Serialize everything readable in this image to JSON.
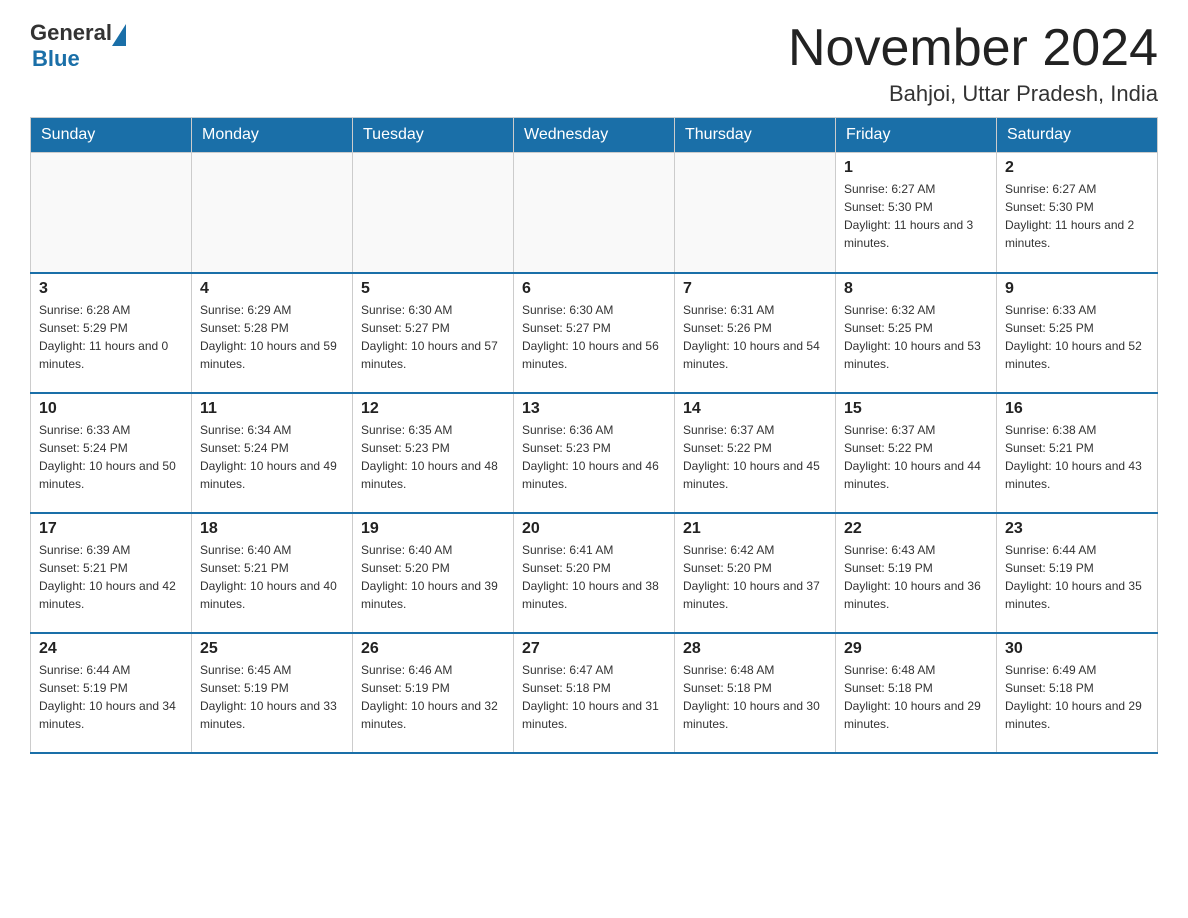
{
  "header": {
    "logo_general": "General",
    "logo_blue": "Blue",
    "title": "November 2024",
    "subtitle": "Bahjoi, Uttar Pradesh, India"
  },
  "days_of_week": [
    "Sunday",
    "Monday",
    "Tuesday",
    "Wednesday",
    "Thursday",
    "Friday",
    "Saturday"
  ],
  "weeks": [
    [
      {
        "day": "",
        "info": ""
      },
      {
        "day": "",
        "info": ""
      },
      {
        "day": "",
        "info": ""
      },
      {
        "day": "",
        "info": ""
      },
      {
        "day": "",
        "info": ""
      },
      {
        "day": "1",
        "info": "Sunrise: 6:27 AM\nSunset: 5:30 PM\nDaylight: 11 hours and 3 minutes."
      },
      {
        "day": "2",
        "info": "Sunrise: 6:27 AM\nSunset: 5:30 PM\nDaylight: 11 hours and 2 minutes."
      }
    ],
    [
      {
        "day": "3",
        "info": "Sunrise: 6:28 AM\nSunset: 5:29 PM\nDaylight: 11 hours and 0 minutes."
      },
      {
        "day": "4",
        "info": "Sunrise: 6:29 AM\nSunset: 5:28 PM\nDaylight: 10 hours and 59 minutes."
      },
      {
        "day": "5",
        "info": "Sunrise: 6:30 AM\nSunset: 5:27 PM\nDaylight: 10 hours and 57 minutes."
      },
      {
        "day": "6",
        "info": "Sunrise: 6:30 AM\nSunset: 5:27 PM\nDaylight: 10 hours and 56 minutes."
      },
      {
        "day": "7",
        "info": "Sunrise: 6:31 AM\nSunset: 5:26 PM\nDaylight: 10 hours and 54 minutes."
      },
      {
        "day": "8",
        "info": "Sunrise: 6:32 AM\nSunset: 5:25 PM\nDaylight: 10 hours and 53 minutes."
      },
      {
        "day": "9",
        "info": "Sunrise: 6:33 AM\nSunset: 5:25 PM\nDaylight: 10 hours and 52 minutes."
      }
    ],
    [
      {
        "day": "10",
        "info": "Sunrise: 6:33 AM\nSunset: 5:24 PM\nDaylight: 10 hours and 50 minutes."
      },
      {
        "day": "11",
        "info": "Sunrise: 6:34 AM\nSunset: 5:24 PM\nDaylight: 10 hours and 49 minutes."
      },
      {
        "day": "12",
        "info": "Sunrise: 6:35 AM\nSunset: 5:23 PM\nDaylight: 10 hours and 48 minutes."
      },
      {
        "day": "13",
        "info": "Sunrise: 6:36 AM\nSunset: 5:23 PM\nDaylight: 10 hours and 46 minutes."
      },
      {
        "day": "14",
        "info": "Sunrise: 6:37 AM\nSunset: 5:22 PM\nDaylight: 10 hours and 45 minutes."
      },
      {
        "day": "15",
        "info": "Sunrise: 6:37 AM\nSunset: 5:22 PM\nDaylight: 10 hours and 44 minutes."
      },
      {
        "day": "16",
        "info": "Sunrise: 6:38 AM\nSunset: 5:21 PM\nDaylight: 10 hours and 43 minutes."
      }
    ],
    [
      {
        "day": "17",
        "info": "Sunrise: 6:39 AM\nSunset: 5:21 PM\nDaylight: 10 hours and 42 minutes."
      },
      {
        "day": "18",
        "info": "Sunrise: 6:40 AM\nSunset: 5:21 PM\nDaylight: 10 hours and 40 minutes."
      },
      {
        "day": "19",
        "info": "Sunrise: 6:40 AM\nSunset: 5:20 PM\nDaylight: 10 hours and 39 minutes."
      },
      {
        "day": "20",
        "info": "Sunrise: 6:41 AM\nSunset: 5:20 PM\nDaylight: 10 hours and 38 minutes."
      },
      {
        "day": "21",
        "info": "Sunrise: 6:42 AM\nSunset: 5:20 PM\nDaylight: 10 hours and 37 minutes."
      },
      {
        "day": "22",
        "info": "Sunrise: 6:43 AM\nSunset: 5:19 PM\nDaylight: 10 hours and 36 minutes."
      },
      {
        "day": "23",
        "info": "Sunrise: 6:44 AM\nSunset: 5:19 PM\nDaylight: 10 hours and 35 minutes."
      }
    ],
    [
      {
        "day": "24",
        "info": "Sunrise: 6:44 AM\nSunset: 5:19 PM\nDaylight: 10 hours and 34 minutes."
      },
      {
        "day": "25",
        "info": "Sunrise: 6:45 AM\nSunset: 5:19 PM\nDaylight: 10 hours and 33 minutes."
      },
      {
        "day": "26",
        "info": "Sunrise: 6:46 AM\nSunset: 5:19 PM\nDaylight: 10 hours and 32 minutes."
      },
      {
        "day": "27",
        "info": "Sunrise: 6:47 AM\nSunset: 5:18 PM\nDaylight: 10 hours and 31 minutes."
      },
      {
        "day": "28",
        "info": "Sunrise: 6:48 AM\nSunset: 5:18 PM\nDaylight: 10 hours and 30 minutes."
      },
      {
        "day": "29",
        "info": "Sunrise: 6:48 AM\nSunset: 5:18 PM\nDaylight: 10 hours and 29 minutes."
      },
      {
        "day": "30",
        "info": "Sunrise: 6:49 AM\nSunset: 5:18 PM\nDaylight: 10 hours and 29 minutes."
      }
    ]
  ]
}
